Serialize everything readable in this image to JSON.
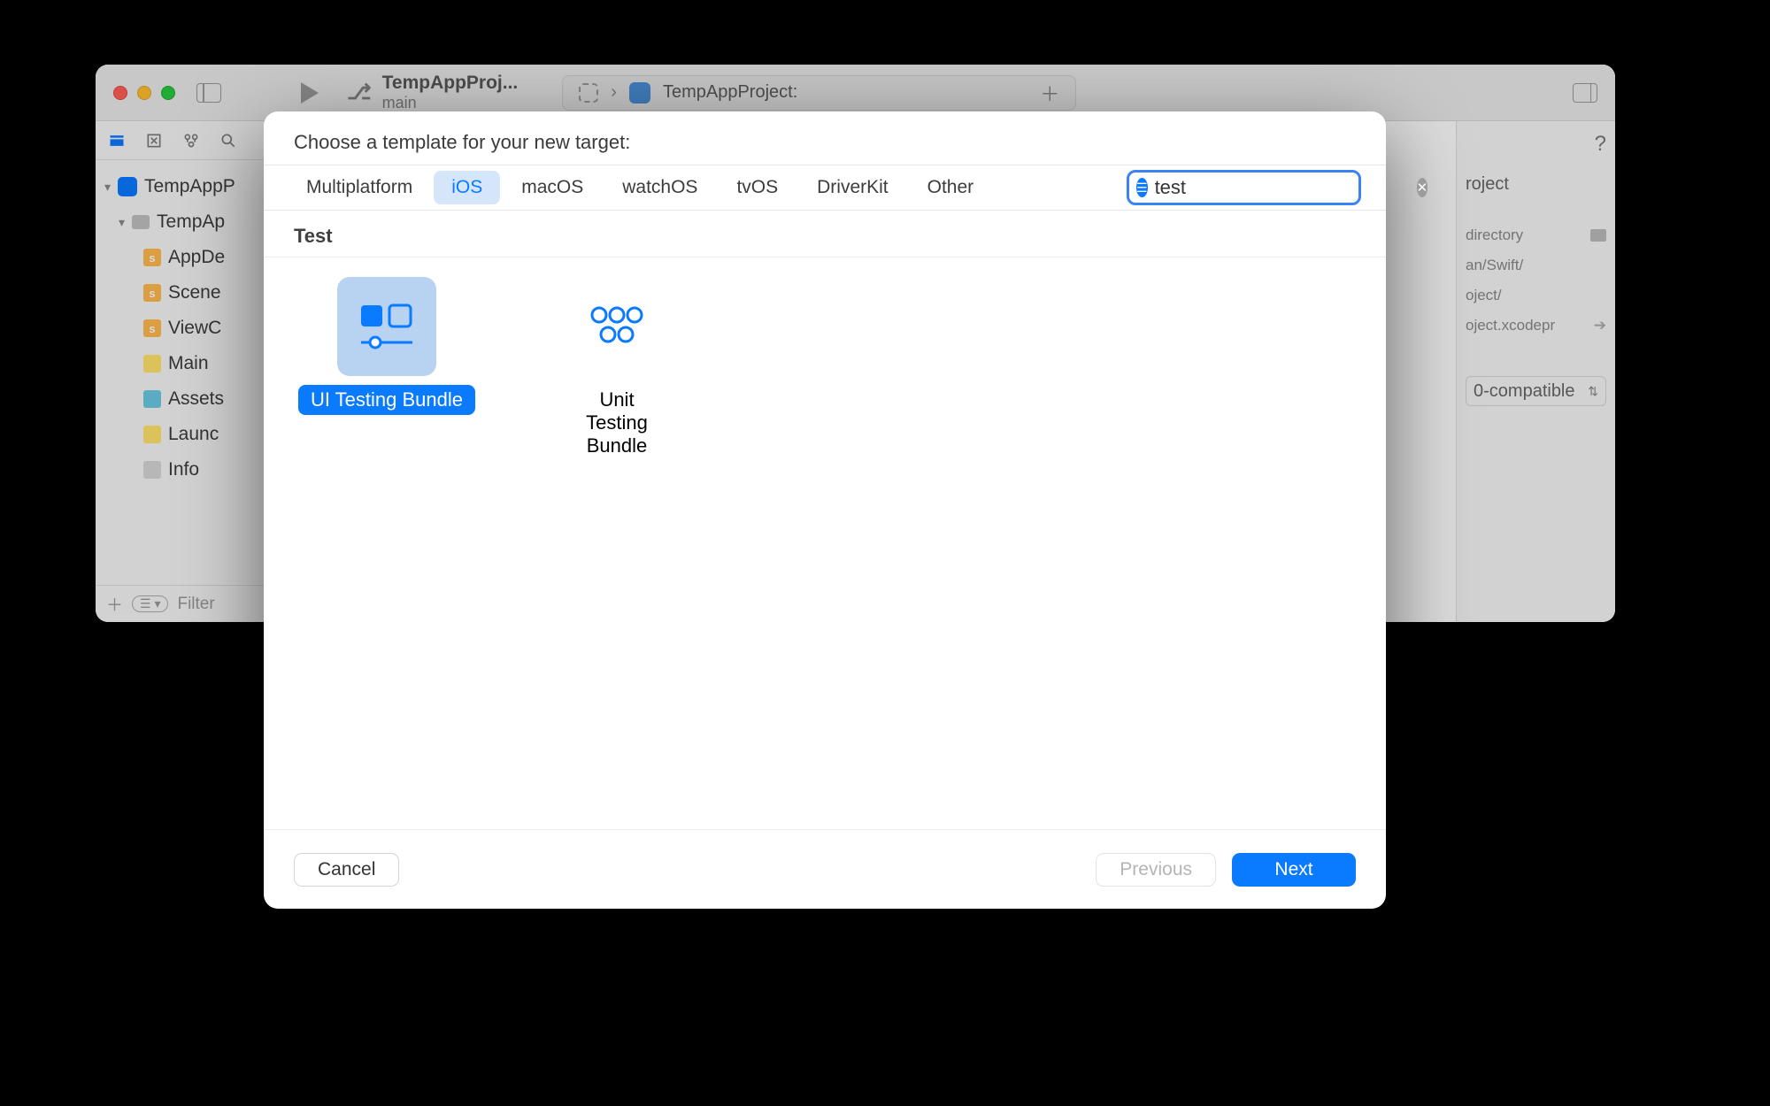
{
  "window": {
    "branch_name": "TempAppProj...",
    "branch_sub": "main",
    "scheme_project": "TempAppProject:"
  },
  "navigator": {
    "project": "TempAppP",
    "folder": "TempAp",
    "files": {
      "appdelegate": "AppDe",
      "scenedelegate": "Scene",
      "viewcontroller": "ViewC",
      "mainstoryboard": "Main",
      "assets": "Assets",
      "launchscreen": "Launc",
      "info": "Info"
    },
    "filter_placeholder": "Filter"
  },
  "inspector": {
    "name_label": "roject",
    "full_path_label": "directory",
    "path_line1": "an/Swift/",
    "path_line2": "oject/",
    "path_line3": "oject.xcodepr",
    "compat_value": "0-compatible"
  },
  "sheet": {
    "title": "Choose a template for your new target:",
    "platforms": {
      "multiplatform": "Multiplatform",
      "ios": "iOS",
      "macos": "macOS",
      "watchos": "watchOS",
      "tvos": "tvOS",
      "driverkit": "DriverKit",
      "other": "Other"
    },
    "search_value": "test",
    "section": "Test",
    "templates": {
      "ui_testing": "UI Testing Bundle",
      "unit_testing": "Unit Testing Bundle"
    },
    "buttons": {
      "cancel": "Cancel",
      "previous": "Previous",
      "next": "Next"
    }
  }
}
